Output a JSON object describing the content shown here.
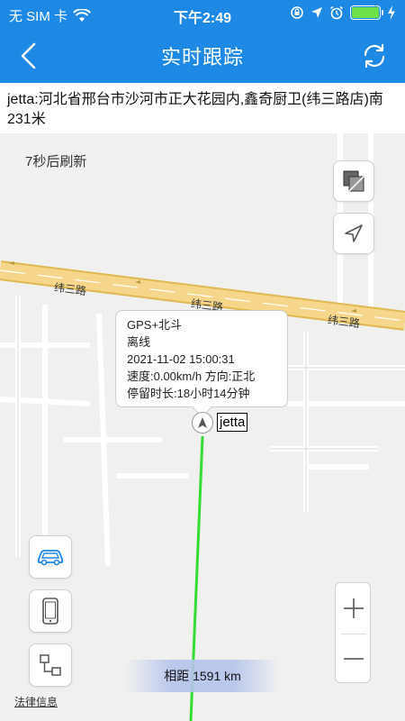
{
  "status_bar": {
    "carrier": "无 SIM 卡",
    "time": "下午2:49",
    "battery_level": 1.0
  },
  "nav": {
    "title": "实时跟踪",
    "back_icon": "chevron-left-icon",
    "refresh_icon": "refresh-icon"
  },
  "address": {
    "text": "jetta:河北省邢台市沙河市正大花园内,鑫奇厨卫(纬三路店)南231米"
  },
  "map": {
    "refresh_hint": "7秒后刷新",
    "road_labels": [
      "纬三路",
      "纬三路",
      "纬三路"
    ],
    "popup": {
      "line1": "GPS+北斗",
      "line2": "离线",
      "line3": "2021-11-02 15:00:31",
      "line4": "速度:0.00km/h 方向:正北",
      "line5": "停留时长:18小时14分钟"
    },
    "vehicle_name": "jetta",
    "distance": "相距 1591 km",
    "legal": "法律信息",
    "colors": {
      "track": "#33dd33",
      "road": "#f5d68a",
      "accent": "#1e88e5"
    }
  }
}
